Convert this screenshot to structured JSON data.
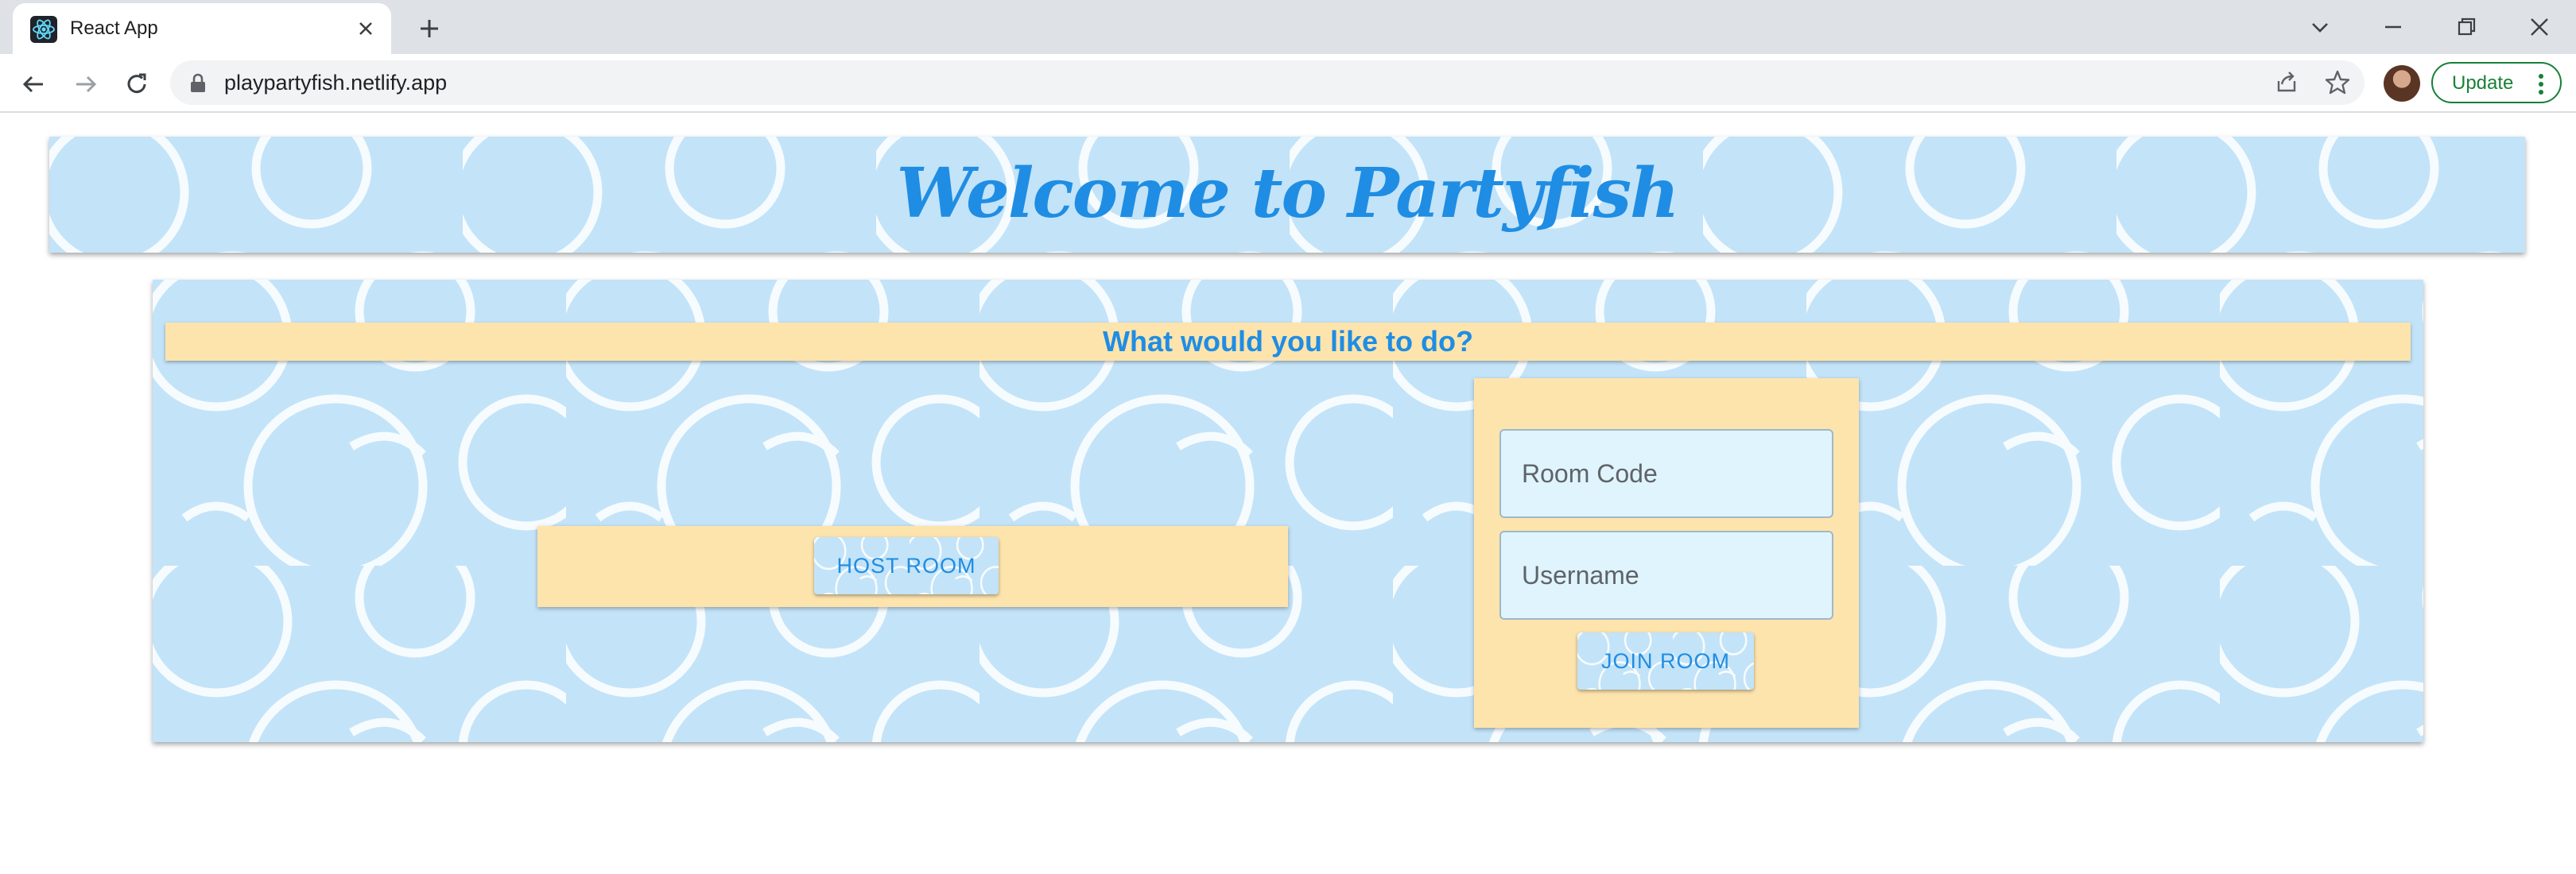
{
  "browser": {
    "tab_title": "React App",
    "url": "playpartyfish.netlify.app",
    "update_label": "Update",
    "colors": {
      "tabstrip": "#dee1e6",
      "update_green": "#188038"
    }
  },
  "page": {
    "header_title": "Welcome to Partyfish",
    "question": "What would you like to do?",
    "host_button": "HOST ROOM",
    "room_code_placeholder": "Room Code",
    "username_placeholder": "Username",
    "join_button": "JOIN ROOM",
    "colors": {
      "accent": "#1f8de3",
      "card": "#fde4ad",
      "bubble_bg": "#c3e3f8"
    }
  }
}
